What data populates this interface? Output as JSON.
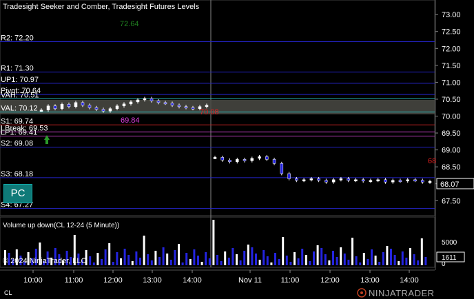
{
  "chart_title": "Tradesight Seeker and Comber, Tradesight Futures Levels",
  "symbol": "CL 12-24",
  "price_axis": {
    "ticks": [
      73.0,
      72.5,
      72.0,
      71.5,
      71.0,
      70.5,
      70.0,
      69.5,
      69.0,
      68.5,
      68.0,
      67.5
    ],
    "current_price": "68.07",
    "min": 67.2,
    "max": 73.35
  },
  "levels": [
    {
      "label": "R2: 72.20",
      "value": 72.2,
      "color": "#2424c8"
    },
    {
      "label": "R1: 71.30",
      "value": 71.3,
      "color": "#2424c8"
    },
    {
      "label": "UP1: 70.97",
      "value": 70.97,
      "color": "#2424c8"
    },
    {
      "label": "Pivot: 70.64",
      "value": 70.64,
      "color": "#2424c8"
    },
    {
      "label": "VAH: 70.51",
      "value": 70.51,
      "color": "#2ab8b8"
    },
    {
      "label": "VAL: 70.12",
      "value": 70.12,
      "color": "#2ab8b8"
    },
    {
      "label": "S1: 69.74",
      "value": 69.74,
      "color": "#c02020"
    },
    {
      "label": "LBreak: 69.53",
      "value": 69.53,
      "color": "#c040c0"
    },
    {
      "label": "LP1: 69.41",
      "value": 69.41,
      "color": "#c040c0"
    },
    {
      "label": "S2: 69.08",
      "value": 69.08,
      "color": "#2424c8"
    },
    {
      "label": "S3: 68.18",
      "value": 68.18,
      "color": "#2424c8"
    },
    {
      "label": "S4: 67.27",
      "value": 67.27,
      "color": "#2424c8"
    }
  ],
  "annotations": [
    {
      "text": "72.64",
      "color": "#208020"
    },
    {
      "text": "69.84",
      "color": "#e040e0"
    },
    {
      "text": "70.08",
      "color": "#e02020"
    },
    {
      "text": "68",
      "color": "#e02020"
    }
  ],
  "pc_button_label": "PC",
  "volume_panel": {
    "title": "Volume up down(CL 12-24 (5 Minute))",
    "ticks": [
      "5000",
      "0"
    ],
    "current_value": "1611"
  },
  "time_axis": [
    "10:00",
    "11:00",
    "12:00",
    "13:00",
    "14:00",
    "Nov 11",
    "11:00",
    "12:00",
    "13:00",
    "14:00"
  ],
  "copyright": "© 2024 NinjaTrader, LLC",
  "footer_symbol": "CL",
  "brand": "NINJATRADER",
  "chart_data": {
    "type": "candlestick",
    "session_1": [
      70.18,
      70.3,
      70.22,
      70.35,
      70.28,
      70.4,
      70.32,
      70.25,
      70.2,
      70.15,
      70.22,
      70.3,
      70.36,
      70.42,
      70.48,
      70.52,
      70.45,
      70.4,
      70.38,
      70.32,
      70.28,
      70.25,
      70.22,
      70.28,
      70.32
    ],
    "session_2": [
      68.78,
      68.7,
      68.65,
      68.72,
      68.68,
      68.75,
      68.8,
      68.72,
      68.6,
      68.3,
      68.15,
      68.1,
      68.12,
      68.15,
      68.1,
      68.05,
      68.12,
      68.15,
      68.1,
      68.12,
      68.08,
      68.1,
      68.12,
      68.05,
      68.1,
      68.08,
      68.12,
      68.1,
      68.05,
      68.07
    ]
  }
}
